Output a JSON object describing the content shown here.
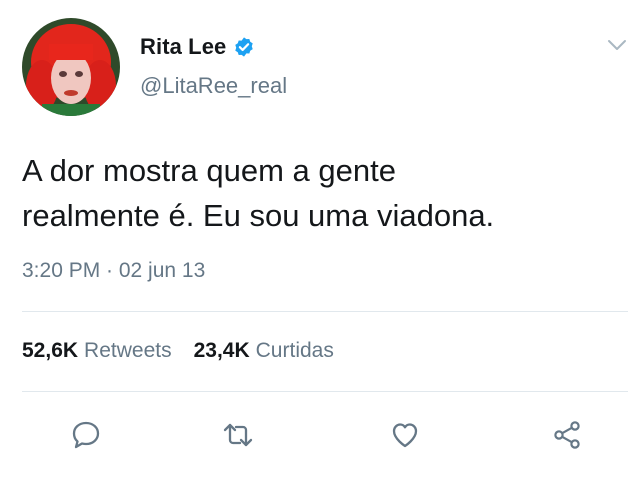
{
  "author": {
    "name": "Rita Lee",
    "handle": "@LitaRee_real",
    "verified": true,
    "avatar_icon": "profile-photo-red-hair"
  },
  "tweet": {
    "text": "A dor mostra quem a gente\nrealmente é. Eu sou uma viadona.",
    "timestamp": "3:20 PM · 02 jun 13"
  },
  "stats": {
    "retweets_count": "52,6K",
    "retweets_label": "Retweets",
    "likes_count": "23,4K",
    "likes_label": "Curtidas"
  },
  "actions": [
    "reply-icon",
    "retweet-icon",
    "like-icon",
    "share-icon"
  ],
  "colors": {
    "text_primary": "#14171a",
    "text_secondary": "#657786",
    "verified_blue": "#1da1f2",
    "divider": "#e1e8ed",
    "icon_gray": "#657786"
  }
}
